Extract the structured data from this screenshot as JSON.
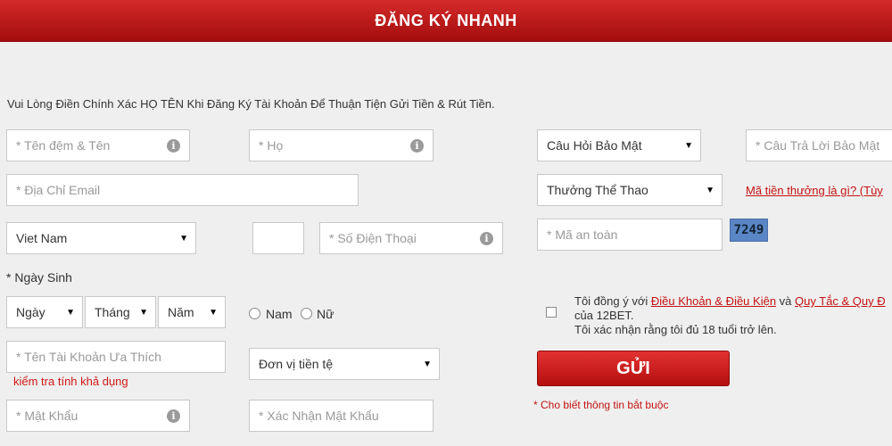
{
  "header": {
    "title": "ĐĂNG KÝ NHANH"
  },
  "notice": "Vui Lòng Điền Chính Xác HỌ TÊN Khi Đăng Ký Tài Khoản Để Thuận Tiện Gửi Tiền & Rút Tiền.",
  "form": {
    "first_name_placeholder": "* Tên đệm & Tên",
    "last_name_placeholder": "* Họ",
    "email_placeholder": "* Địa Chỉ Email",
    "country_value": "Viet Nam",
    "phone_code_value": "",
    "phone_placeholder": "* Số Điện Thoại",
    "dob_label": "* Ngày Sinh",
    "day_value": "Ngày",
    "month_value": "Tháng",
    "year_value": "Năm",
    "gender_male": "Nam",
    "gender_female": "Nữ",
    "username_placeholder": "* Tên Tài Khoản Ưa Thích",
    "check_availability": "kiểm tra tính khả dụng",
    "currency_value": "Đơn vị tiền tệ",
    "password_placeholder": "* Mật Khẩu",
    "confirm_password_placeholder": "* Xác Nhận Mật Khẩu",
    "security_question_value": "Câu Hỏi Bảo Mật",
    "security_answer_placeholder": "* Câu Trả Lời Bảo Mật",
    "bonus_value": "Thưởng Thể Thao",
    "bonus_link": "Mã tiền thưởng là gì? (Tùy",
    "security_code_placeholder": "* Mã an toàn",
    "captcha_code": "7249",
    "terms_prefix": "Tôi đồng ý với ",
    "terms_link1": "Điều Khoản & Điều Kiện",
    "terms_and": " và ",
    "terms_link2": "Quy Tắc & Quy Đ",
    "terms_line2": "của 12BET.",
    "terms_line3": "Tôi xác nhận rằng tôi đủ 18 tuổi trở lên.",
    "submit_label": "GỬI",
    "required_note": "* Cho biết thông tin bắt buộc"
  },
  "icons": {
    "info": "info-icon",
    "dropdown": "chevron-down-icon"
  },
  "colors": {
    "header": "#c11a1a",
    "accent": "#c41212",
    "captcha": "#5a86c5"
  }
}
